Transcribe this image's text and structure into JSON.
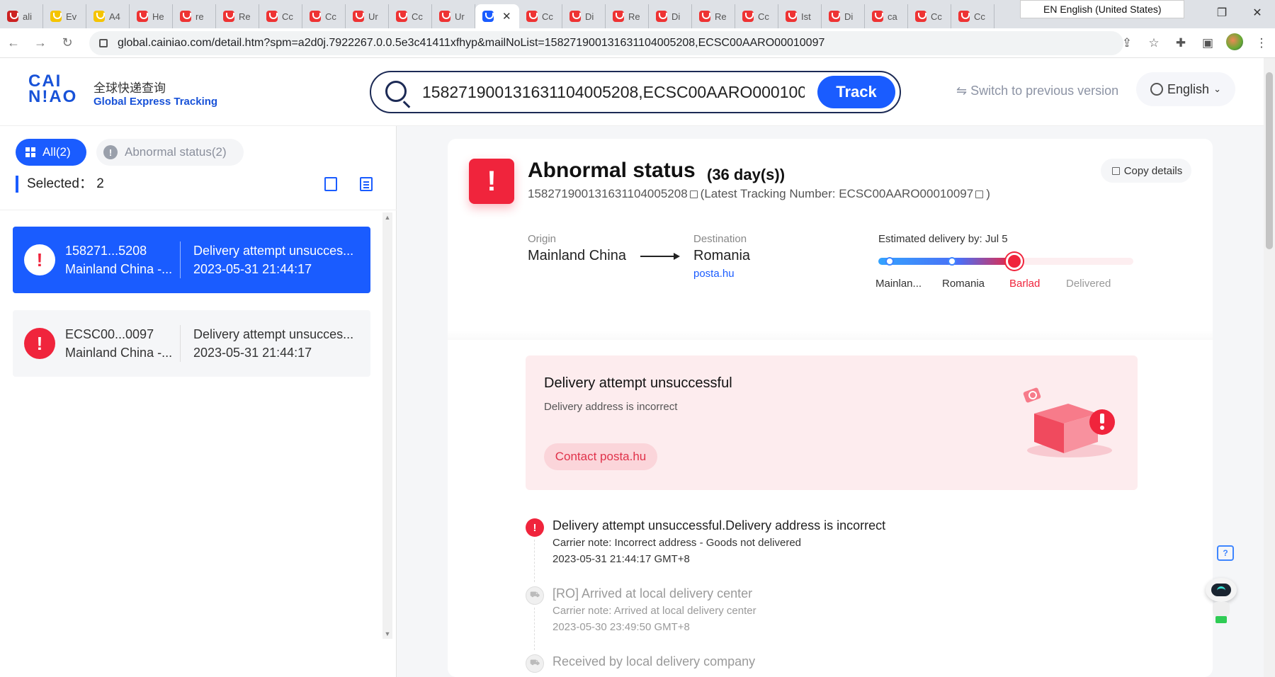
{
  "browser": {
    "tabs": [
      {
        "title": "ali",
        "icon": "flag"
      },
      {
        "title": "Ev",
        "icon": "yellow"
      },
      {
        "title": "A4",
        "icon": "yellow"
      },
      {
        "title": "He",
        "icon": "red"
      },
      {
        "title": "re",
        "icon": "red"
      },
      {
        "title": "Re",
        "icon": "red"
      },
      {
        "title": "Cc",
        "icon": "red"
      },
      {
        "title": "Cc",
        "icon": "red"
      },
      {
        "title": "Ur",
        "icon": "red"
      },
      {
        "title": "Cc",
        "icon": "red"
      },
      {
        "title": "Ur",
        "icon": "red"
      }
    ],
    "active_tab_close": "✕",
    "tabs_after": [
      {
        "title": "Cc"
      },
      {
        "title": "Di"
      },
      {
        "title": "Re"
      },
      {
        "title": "Di"
      },
      {
        "title": "Re"
      },
      {
        "title": "Cc"
      },
      {
        "title": "Ist"
      },
      {
        "title": "Di"
      },
      {
        "title": "ca"
      },
      {
        "title": "Cc"
      },
      {
        "title": "Cc"
      }
    ],
    "lang_popup": "EN English (United States)",
    "url": "global.cainiao.com/detail.htm?spm=a2d0j.7922267.0.0.5e3c41411xfhyp&mailNoList=158271900131631104005208,ECSC00AARO00010097"
  },
  "header": {
    "logo_mark_line1": "CAI",
    "logo_mark_line2": "N!AO",
    "logo_cn": "全球快递查询",
    "logo_en": "Global Express Tracking",
    "search_value": "158271900131631104005208,ECSC00AARO00010097",
    "track_label": "Track",
    "switch_version": "⇋ Switch to previous version",
    "language": "English"
  },
  "left": {
    "filter_all": "All(2)",
    "filter_abnormal": "Abnormal status(2)",
    "selected_label": "Selected：",
    "selected_count": "2",
    "packages": [
      {
        "id": "158271...5208",
        "route": "Mainland China -...",
        "status": "Delivery attempt unsucces...",
        "time": "2023-05-31 21:44:17"
      },
      {
        "id": "ECSC00...0097",
        "route": "Mainland China -...",
        "status": "Delivery attempt unsucces...",
        "time": "2023-05-31 21:44:17"
      }
    ]
  },
  "main": {
    "status_title": "Abnormal status",
    "status_days": "(36 day(s))",
    "tracking_number": "158271900131631104005208",
    "latest_tracking": "(Latest Tracking Number: ECSC00AARO00010097",
    "latest_close": ")",
    "copy_details": "Copy details",
    "origin_label": "Origin",
    "origin_value": "Mainland China",
    "destination_label": "Destination",
    "destination_value": "Romania",
    "destination_carrier": "posta.hu",
    "estimated_delivery": "Estimated delivery by:  Jul 5",
    "progress_fraction": 0.53,
    "progress_nodes": [
      "Mainlan...",
      "Romania",
      "Barlad",
      "Delivered"
    ],
    "alert_title": "Delivery attempt unsuccessful",
    "alert_sub": "Delivery address is incorrect",
    "contact_label": "Contact posta.hu",
    "events": [
      {
        "title": "Delivery attempt unsuccessful.Delivery address is incorrect",
        "note": "Carrier note: Incorrect address - Goods not delivered",
        "time": "2023-05-31 21:44:17 GMT+8"
      },
      {
        "title": "[RO] Arrived at local delivery center",
        "note": "Carrier note: Arrived at local delivery center",
        "time": "2023-05-30 23:49:50 GMT+8"
      },
      {
        "title": "Received by local delivery company",
        "note": "",
        "time": ""
      }
    ]
  },
  "colors": {
    "accent": "#1a5cff",
    "alert": "#f0243c",
    "alert_bg": "#fdecee"
  }
}
